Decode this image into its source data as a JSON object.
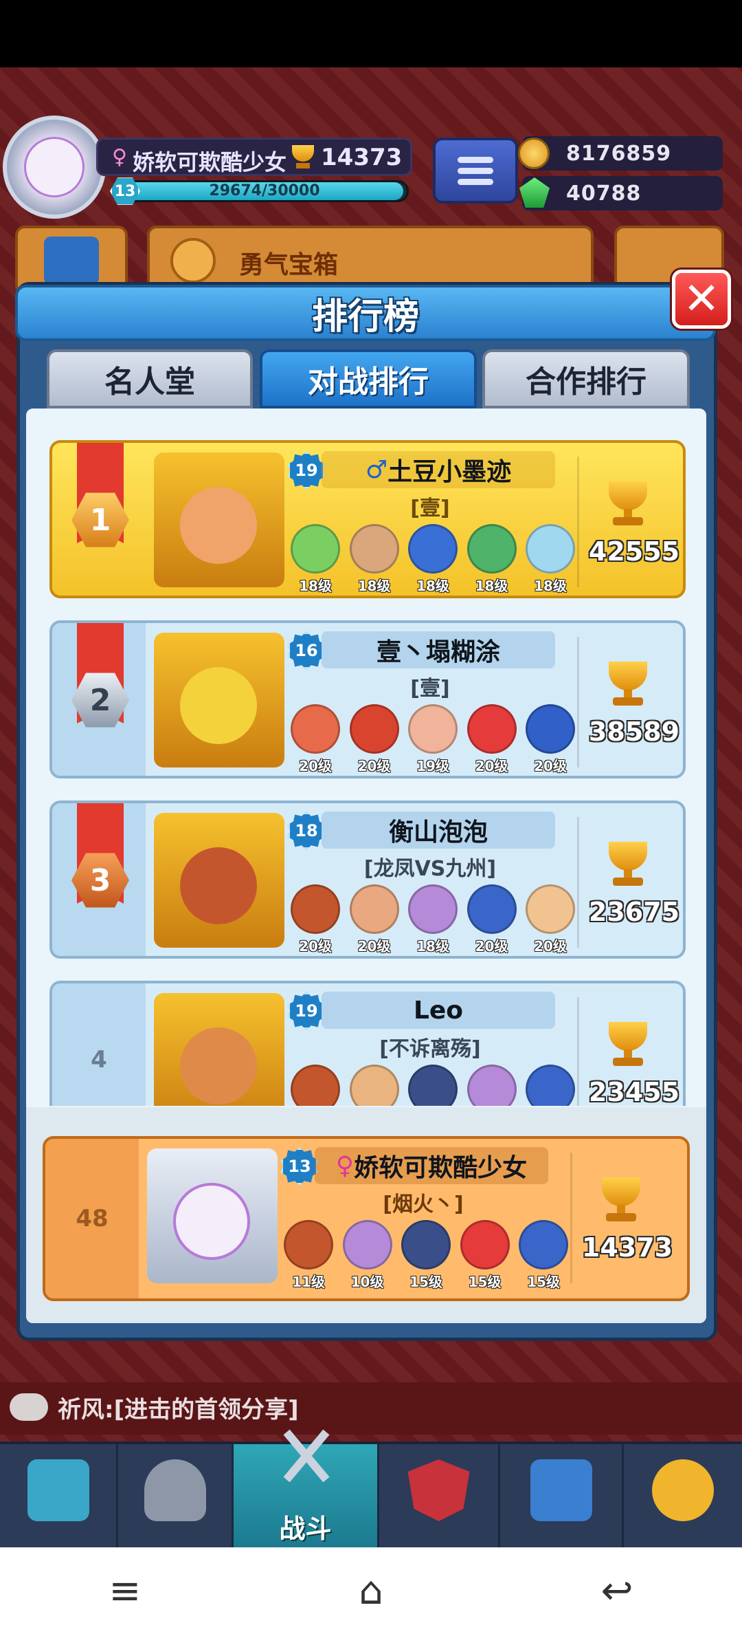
{
  "hud": {
    "player_name": "娇软可欺酷少女",
    "trophies": "14373",
    "level": "13",
    "exp_text": "29674/30000",
    "exp_fraction": 0.989,
    "gold": "8176859",
    "gems": "40788",
    "chest_label": "勇气宝箱"
  },
  "panel": {
    "title": "排行榜",
    "close_label": "✕",
    "tabs": [
      {
        "label": "名人堂",
        "active": false
      },
      {
        "label": "对战排行",
        "active": true
      },
      {
        "label": "合作排行",
        "active": false
      }
    ]
  },
  "rows": [
    {
      "rank": "1",
      "level": "19",
      "gender": "♂",
      "name": "土豆小墨迹",
      "guild": "[壹]",
      "score": "42555",
      "heroes": [
        "18级",
        "18级",
        "18级",
        "18级",
        "18级"
      ],
      "hero_colors": [
        "#7bcf62",
        "#d9a77b",
        "#3a6fd6",
        "#4fb36a",
        "#9fd8ef"
      ]
    },
    {
      "rank": "2",
      "level": "16",
      "gender": "",
      "name": "壹丶塌糊涂",
      "guild": "[壹]",
      "score": "38589",
      "heroes": [
        "20级",
        "20级",
        "19级",
        "20级",
        "20级"
      ],
      "hero_colors": [
        "#e76b4a",
        "#d9442f",
        "#f0b49a",
        "#e53b3b",
        "#3060c8"
      ]
    },
    {
      "rank": "3",
      "level": "18",
      "gender": "",
      "name": "衡山泡泡",
      "guild": "[龙凤VS九州]",
      "score": "23675",
      "heroes": [
        "20级",
        "20级",
        "18级",
        "20级",
        "20级"
      ],
      "hero_colors": [
        "#c4562d",
        "#e9a880",
        "#b58ad8",
        "#3a66c9",
        "#f0c391"
      ]
    },
    {
      "rank": "4",
      "level": "19",
      "gender": "",
      "name": "Leo",
      "guild": "[不诉离殇]",
      "score": "23455",
      "heroes": [
        "",
        "",
        "",
        "",
        ""
      ],
      "hero_colors": [
        "#c4562d",
        "#e9b480",
        "#3a4f8a",
        "#b58ad8",
        "#3a66c9"
      ]
    }
  ],
  "self_row": {
    "rank": "48",
    "level": "13",
    "gender": "♀",
    "name": "娇软可欺酷少女",
    "guild": "[烟火丶]",
    "score": "14373",
    "heroes": [
      "11级",
      "10级",
      "15级",
      "15级",
      "15级"
    ],
    "hero_colors": [
      "#c4562d",
      "#b58ad8",
      "#3a4f8a",
      "#e53b3b",
      "#3a66c9"
    ]
  },
  "chat": {
    "text": "祈风:[进击的首领分享]"
  },
  "bottom_nav": {
    "active_label": "战斗",
    "items": [
      "chest-icon",
      "knight-helmet-icon",
      "battle-swords-icon",
      "crown-shield-icon",
      "team-icon",
      "compass-icon"
    ]
  },
  "system_nav": {
    "menu": "≡",
    "home": "⌂",
    "back": "↩"
  }
}
